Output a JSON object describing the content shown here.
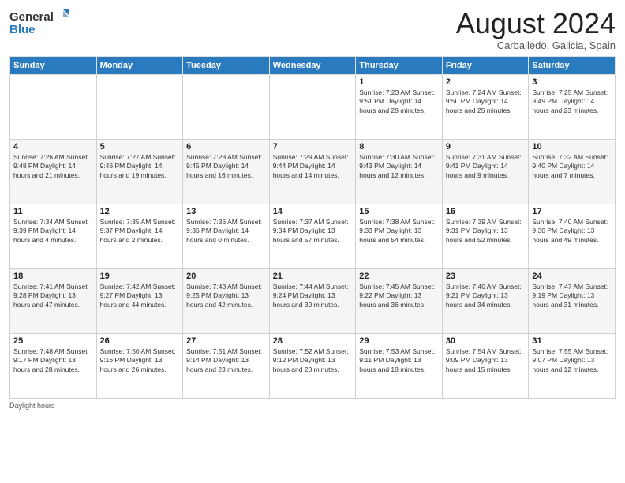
{
  "logo": {
    "general": "General",
    "blue": "Blue"
  },
  "header": {
    "month_year": "August 2024",
    "location": "Carballedo, Galicia, Spain"
  },
  "days_of_week": [
    "Sunday",
    "Monday",
    "Tuesday",
    "Wednesday",
    "Thursday",
    "Friday",
    "Saturday"
  ],
  "weeks": [
    [
      {
        "day": "",
        "info": ""
      },
      {
        "day": "",
        "info": ""
      },
      {
        "day": "",
        "info": ""
      },
      {
        "day": "",
        "info": ""
      },
      {
        "day": "1",
        "info": "Sunrise: 7:23 AM\nSunset: 9:51 PM\nDaylight: 14 hours\nand 28 minutes."
      },
      {
        "day": "2",
        "info": "Sunrise: 7:24 AM\nSunset: 9:50 PM\nDaylight: 14 hours\nand 25 minutes."
      },
      {
        "day": "3",
        "info": "Sunrise: 7:25 AM\nSunset: 9:49 PM\nDaylight: 14 hours\nand 23 minutes."
      }
    ],
    [
      {
        "day": "4",
        "info": "Sunrise: 7:26 AM\nSunset: 9:48 PM\nDaylight: 14 hours\nand 21 minutes."
      },
      {
        "day": "5",
        "info": "Sunrise: 7:27 AM\nSunset: 9:46 PM\nDaylight: 14 hours\nand 19 minutes."
      },
      {
        "day": "6",
        "info": "Sunrise: 7:28 AM\nSunset: 9:45 PM\nDaylight: 14 hours\nand 16 minutes."
      },
      {
        "day": "7",
        "info": "Sunrise: 7:29 AM\nSunset: 9:44 PM\nDaylight: 14 hours\nand 14 minutes."
      },
      {
        "day": "8",
        "info": "Sunrise: 7:30 AM\nSunset: 9:43 PM\nDaylight: 14 hours\nand 12 minutes."
      },
      {
        "day": "9",
        "info": "Sunrise: 7:31 AM\nSunset: 9:41 PM\nDaylight: 14 hours\nand 9 minutes."
      },
      {
        "day": "10",
        "info": "Sunrise: 7:32 AM\nSunset: 9:40 PM\nDaylight: 14 hours\nand 7 minutes."
      }
    ],
    [
      {
        "day": "11",
        "info": "Sunrise: 7:34 AM\nSunset: 9:39 PM\nDaylight: 14 hours\nand 4 minutes."
      },
      {
        "day": "12",
        "info": "Sunrise: 7:35 AM\nSunset: 9:37 PM\nDaylight: 14 hours\nand 2 minutes."
      },
      {
        "day": "13",
        "info": "Sunrise: 7:36 AM\nSunset: 9:36 PM\nDaylight: 14 hours\nand 0 minutes."
      },
      {
        "day": "14",
        "info": "Sunrise: 7:37 AM\nSunset: 9:34 PM\nDaylight: 13 hours\nand 57 minutes."
      },
      {
        "day": "15",
        "info": "Sunrise: 7:38 AM\nSunset: 9:33 PM\nDaylight: 13 hours\nand 54 minutes."
      },
      {
        "day": "16",
        "info": "Sunrise: 7:39 AM\nSunset: 9:31 PM\nDaylight: 13 hours\nand 52 minutes."
      },
      {
        "day": "17",
        "info": "Sunrise: 7:40 AM\nSunset: 9:30 PM\nDaylight: 13 hours\nand 49 minutes."
      }
    ],
    [
      {
        "day": "18",
        "info": "Sunrise: 7:41 AM\nSunset: 9:28 PM\nDaylight: 13 hours\nand 47 minutes."
      },
      {
        "day": "19",
        "info": "Sunrise: 7:42 AM\nSunset: 9:27 PM\nDaylight: 13 hours\nand 44 minutes."
      },
      {
        "day": "20",
        "info": "Sunrise: 7:43 AM\nSunset: 9:25 PM\nDaylight: 13 hours\nand 42 minutes."
      },
      {
        "day": "21",
        "info": "Sunrise: 7:44 AM\nSunset: 9:24 PM\nDaylight: 13 hours\nand 39 minutes."
      },
      {
        "day": "22",
        "info": "Sunrise: 7:45 AM\nSunset: 9:22 PM\nDaylight: 13 hours\nand 36 minutes."
      },
      {
        "day": "23",
        "info": "Sunrise: 7:46 AM\nSunset: 9:21 PM\nDaylight: 13 hours\nand 34 minutes."
      },
      {
        "day": "24",
        "info": "Sunrise: 7:47 AM\nSunset: 9:19 PM\nDaylight: 13 hours\nand 31 minutes."
      }
    ],
    [
      {
        "day": "25",
        "info": "Sunrise: 7:48 AM\nSunset: 9:17 PM\nDaylight: 13 hours\nand 28 minutes."
      },
      {
        "day": "26",
        "info": "Sunrise: 7:50 AM\nSunset: 9:16 PM\nDaylight: 13 hours\nand 26 minutes."
      },
      {
        "day": "27",
        "info": "Sunrise: 7:51 AM\nSunset: 9:14 PM\nDaylight: 13 hours\nand 23 minutes."
      },
      {
        "day": "28",
        "info": "Sunrise: 7:52 AM\nSunset: 9:12 PM\nDaylight: 13 hours\nand 20 minutes."
      },
      {
        "day": "29",
        "info": "Sunrise: 7:53 AM\nSunset: 9:11 PM\nDaylight: 13 hours\nand 18 minutes."
      },
      {
        "day": "30",
        "info": "Sunrise: 7:54 AM\nSunset: 9:09 PM\nDaylight: 13 hours\nand 15 minutes."
      },
      {
        "day": "31",
        "info": "Sunrise: 7:55 AM\nSunset: 9:07 PM\nDaylight: 13 hours\nand 12 minutes."
      }
    ]
  ],
  "footer": {
    "daylight_label": "Daylight hours"
  }
}
